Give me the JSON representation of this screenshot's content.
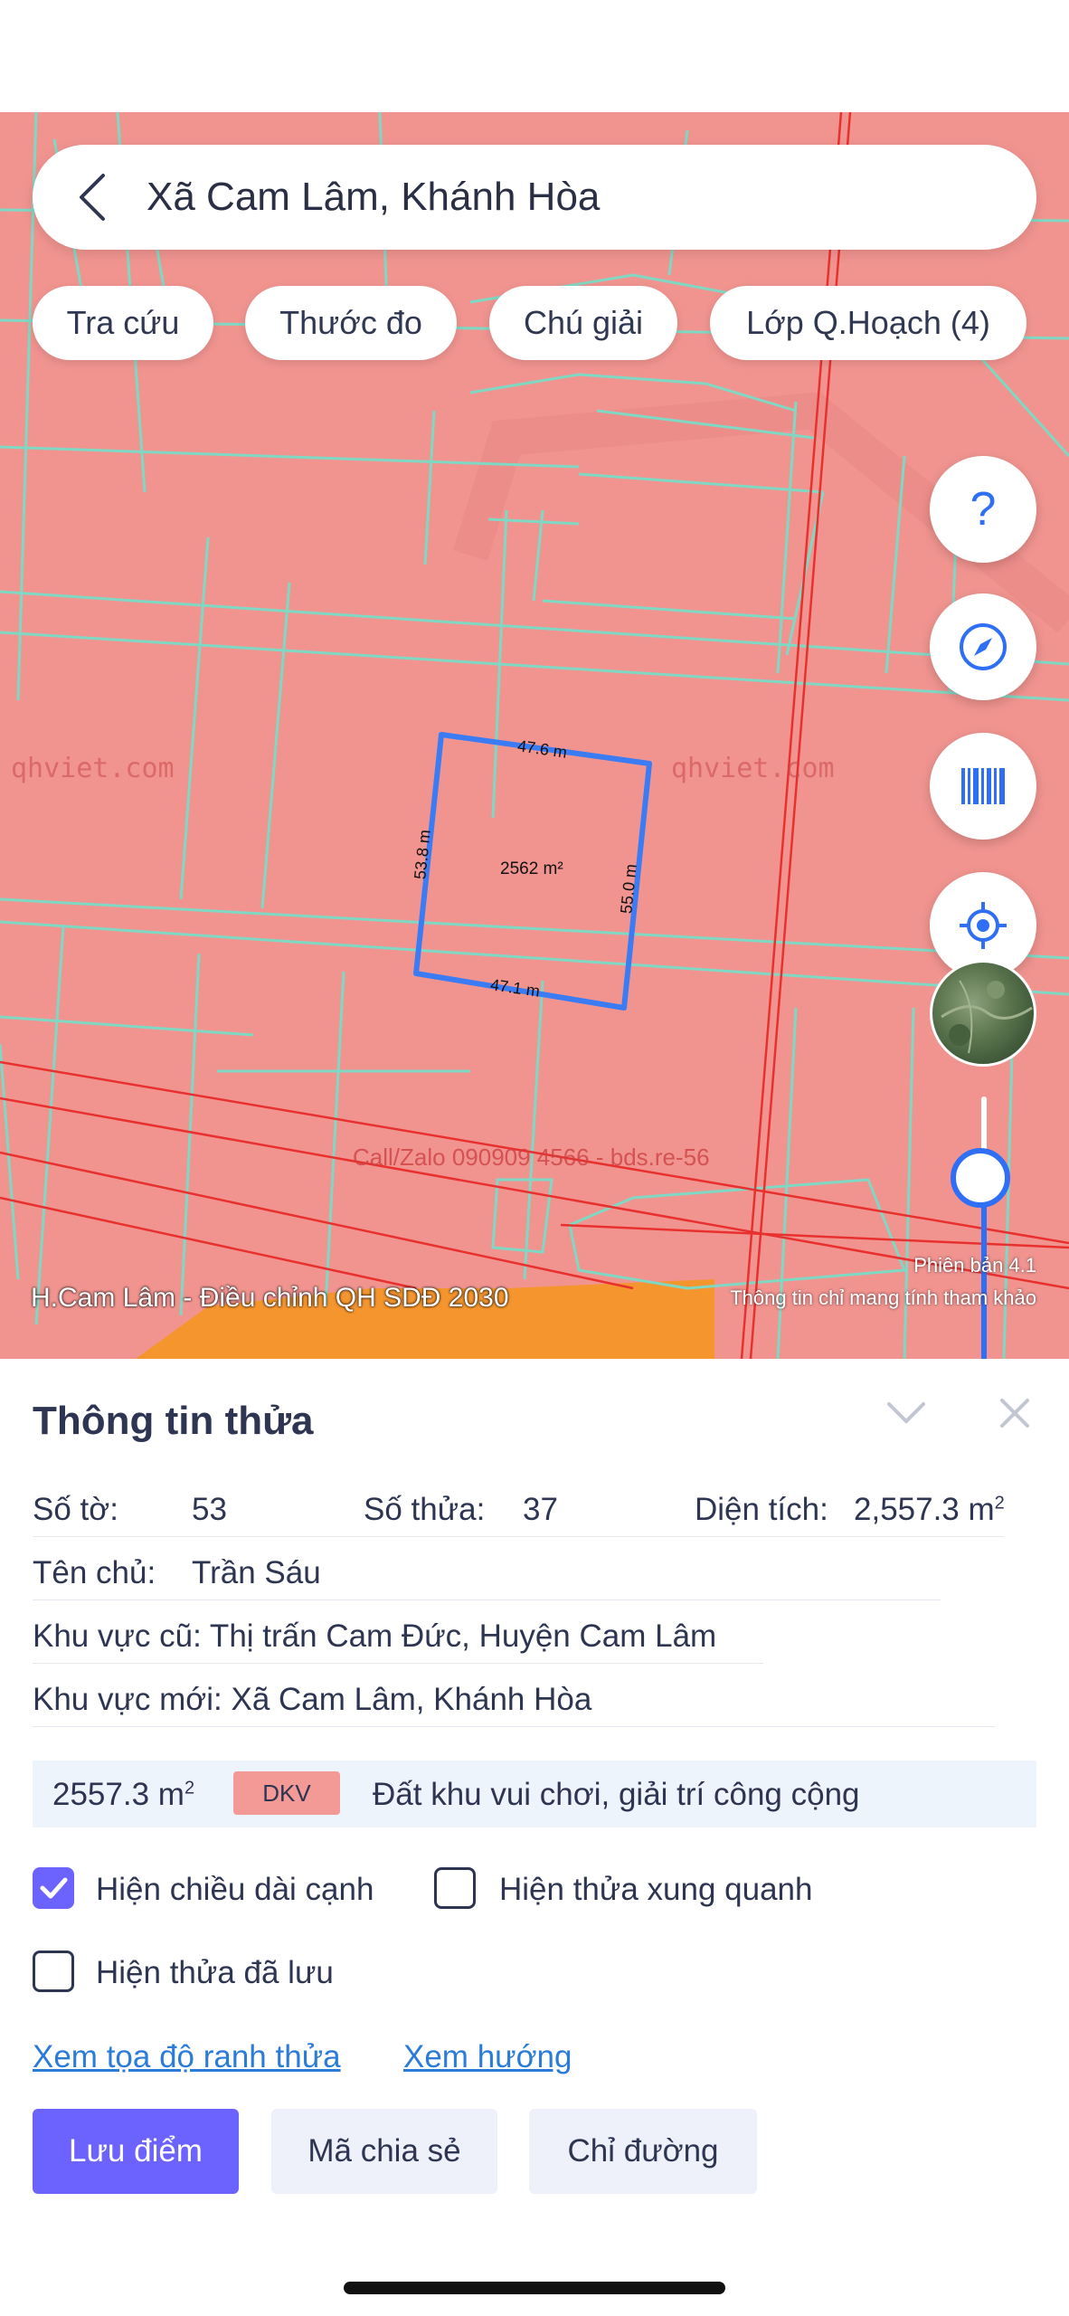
{
  "search": {
    "title": "Xã Cam Lâm, Khánh Hòa"
  },
  "chips": [
    "Tra cứu",
    "Thước đo",
    "Chú giải",
    "Lớp Q.Hoạch (4)"
  ],
  "fab_buttons": {
    "help_label": "?",
    "icons": [
      "help-icon",
      "compass-icon",
      "barcode-icon",
      "locate-icon",
      "satellite-thumbnail"
    ]
  },
  "map": {
    "watermark": "qhviet.com",
    "parcel": {
      "area": "2562 m²",
      "edge_top": "47.6 m",
      "edge_right": "55.0 m",
      "edge_bottom": "47.1 m",
      "edge_left": "53.8 m"
    },
    "call_text": "Call/Zalo 090909 4566 - bds.re-56",
    "caption": "H.Cam Lâm - Điều chỉnh QH SDĐ 2030",
    "version": "Phiên bản 4.1",
    "disclaimer": "Thông tin chỉ mang tính tham khảo",
    "zoom_level": 0.68,
    "colors": {
      "land": "#f19490",
      "parcel_line": "#7fd8c4",
      "boundary": "#e8312f",
      "highlight": "#3b7cf5",
      "zone": "#f5952e"
    }
  },
  "panel": {
    "title": "Thông tin thửa",
    "so_to_label": "Số tờ:",
    "so_to_value": "53",
    "so_thua_label": "Số thửa:",
    "so_thua_value": "37",
    "dien_tich_label": "Diện tích:",
    "dien_tich_value": "2,557.3 m",
    "dien_tich_unit_sup": "2",
    "chu_label": "Tên chủ:",
    "chu_value": "Trần Sáu",
    "khu_vuc_cu": "Khu vực cũ: Thị trấn Cam Đức, Huyện Cam Lâm",
    "khu_vuc_moi": "Khu vực mới: Xã Cam Lâm, Khánh Hòa",
    "landuse": {
      "area": "2557.3 m",
      "area_sup": "2",
      "code": "DKV",
      "description": "Đất khu vui chơi, giải trí công cộng"
    },
    "options": [
      {
        "label": "Hiện chiều dài cạnh",
        "checked": true
      },
      {
        "label": "Hiện thửa xung quanh",
        "checked": false
      },
      {
        "label": "Hiện thửa đã lưu",
        "checked": false
      }
    ],
    "links": [
      "Xem tọa độ ranh thửa",
      "Xem hướng"
    ],
    "buttons": {
      "save": "Lưu điểm",
      "share": "Mã chia sẻ",
      "directions": "Chỉ đường"
    }
  }
}
